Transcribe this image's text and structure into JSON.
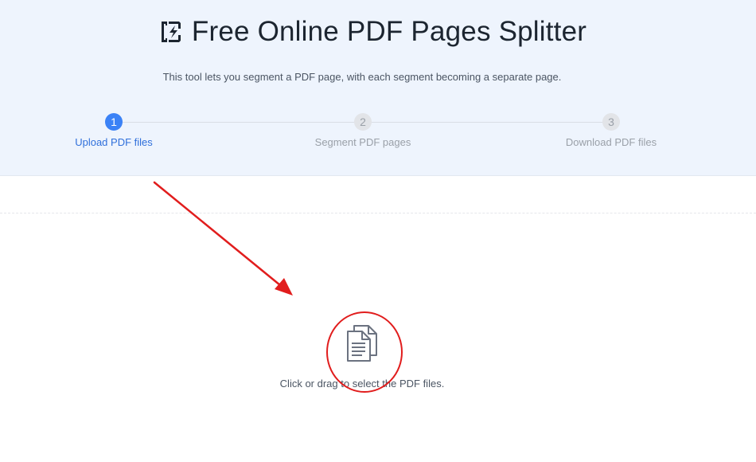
{
  "header": {
    "title": "Free Online PDF Pages Splitter",
    "subtitle": "This tool lets you segment a PDF page, with each segment becoming a separate page.",
    "logo_icon": "pdf-split-logo-icon"
  },
  "steps": [
    {
      "number": "1",
      "label": "Upload PDF files",
      "state": "active"
    },
    {
      "number": "2",
      "label": "Segment PDF pages",
      "state": "inactive"
    },
    {
      "number": "3",
      "label": "Download PDF files",
      "state": "inactive"
    }
  ],
  "upload": {
    "icon": "documents-icon",
    "text": "Click or drag to select the PDF files."
  },
  "colors": {
    "header_bg": "#eef4fd",
    "accent": "#3b82f6",
    "annotation": "#e11d1d"
  }
}
